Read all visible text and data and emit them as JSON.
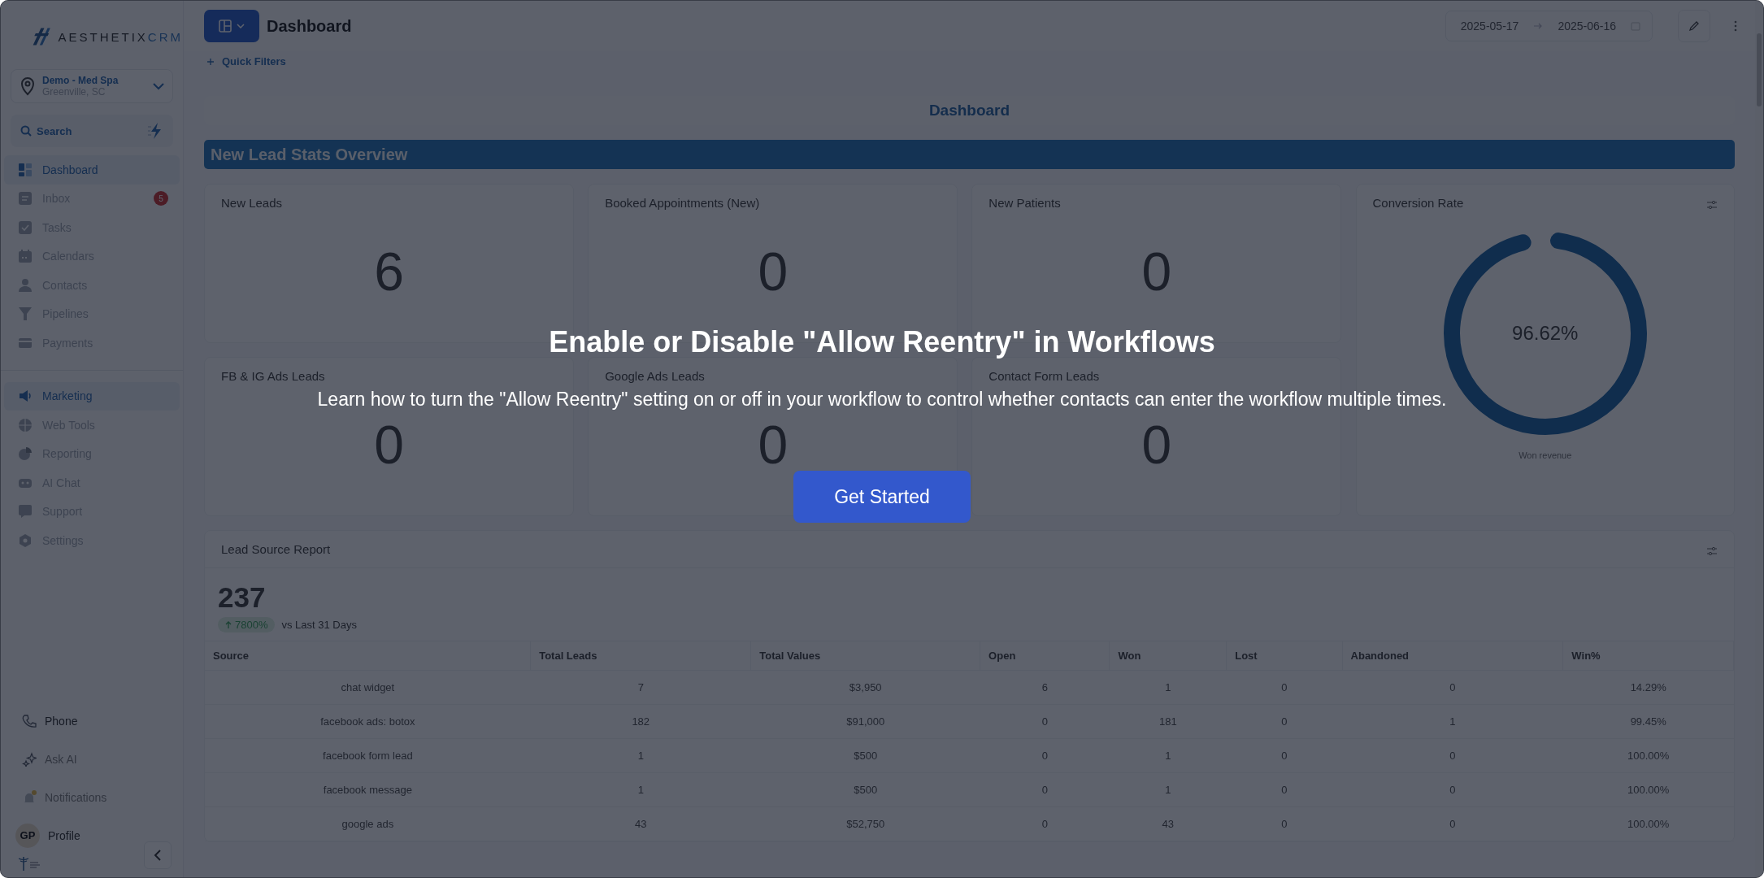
{
  "sidebar": {
    "brand": {
      "name": "AESTHETIX",
      "suffix": "CRM"
    },
    "location": {
      "name": "Demo - Med Spa",
      "place": "Greenville, SC"
    },
    "search": {
      "label": "Search"
    },
    "items": [
      {
        "kind": "dashboard",
        "label": "Dashboard",
        "selected": true
      },
      {
        "kind": "inbox",
        "label": "Inbox",
        "selected": false,
        "badge": "5"
      },
      {
        "kind": "tasks",
        "label": "Tasks",
        "selected": false
      },
      {
        "kind": "calendars",
        "label": "Calendars",
        "selected": false
      },
      {
        "kind": "contacts",
        "label": "Contacts",
        "selected": false
      },
      {
        "kind": "pipelines",
        "label": "Pipelines",
        "selected": false
      },
      {
        "kind": "payments",
        "label": "Payments",
        "selected": false
      }
    ],
    "items_2": [
      {
        "kind": "marketing",
        "label": "Marketing",
        "selected": true
      },
      {
        "kind": "webtools",
        "label": "Web Tools",
        "selected": false
      },
      {
        "kind": "reporting",
        "label": "Reporting",
        "selected": false
      },
      {
        "kind": "aichat",
        "label": "AI Chat",
        "selected": false
      },
      {
        "kind": "support",
        "label": "Support",
        "selected": false
      },
      {
        "kind": "settings",
        "label": "Settings",
        "selected": false
      }
    ],
    "bottom": [
      {
        "kind": "phone",
        "label": "Phone"
      },
      {
        "kind": "askai",
        "label": "Ask AI"
      },
      {
        "kind": "notifications",
        "label": "Notifications"
      },
      {
        "kind": "profile",
        "label": "Profile",
        "initials": "GP"
      }
    ]
  },
  "header": {
    "title": "Dashboard",
    "date_from": "2025-05-17",
    "date_to": "2025-06-16",
    "quick_filters": "Quick Filters"
  },
  "dashboard_title": "Dashboard",
  "section_title": "New Lead Stats Overview",
  "stat_cards": [
    {
      "label": "New Leads",
      "value": "6"
    },
    {
      "label": "Booked Appointments (New)",
      "value": "0"
    },
    {
      "label": "New Patients",
      "value": "0"
    },
    {
      "label": "FB & IG Ads Leads",
      "value": "0"
    },
    {
      "label": "Google Ads Leads",
      "value": "0"
    },
    {
      "label": "Contact Form Leads",
      "value": "0"
    }
  ],
  "conversion": {
    "title": "Conversion Rate",
    "reading": "96.62%",
    "level": 0.9662,
    "caption": "Won revenue"
  },
  "lead_source": {
    "title": "Lead Source Report",
    "total": "237",
    "change": "7800%",
    "comparison": "vs Last 31 Days",
    "columns": [
      "Source",
      "Total Leads",
      "Total Values",
      "Open",
      "Won",
      "Lost",
      "Abandoned",
      "Win%"
    ],
    "rows": [
      [
        "chat widget",
        "7",
        "$3,950",
        "6",
        "1",
        "0",
        "0",
        "14.29%"
      ],
      [
        "facebook ads: botox",
        "182",
        "$91,000",
        "0",
        "181",
        "0",
        "1",
        "99.45%"
      ],
      [
        "facebook form lead",
        "1",
        "$500",
        "0",
        "1",
        "0",
        "0",
        "100.00%"
      ],
      [
        "facebook message",
        "1",
        "$500",
        "0",
        "1",
        "0",
        "0",
        "100.00%"
      ],
      [
        "google ads",
        "43",
        "$52,750",
        "0",
        "43",
        "0",
        "0",
        "100.00%"
      ]
    ]
  },
  "overlay": {
    "title": "Enable or Disable \"Allow Reentry\" in Workflows",
    "text": "Learn how to turn the \"Allow Reentry\" setting on or off in your workflow to control whether contacts can enter the workflow multiple times.",
    "button": "Get Started"
  }
}
